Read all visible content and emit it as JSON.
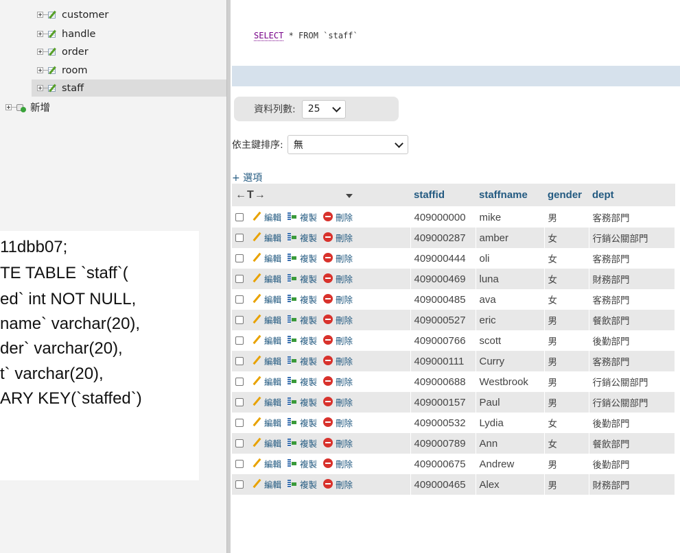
{
  "navigation": {
    "tables": [
      {
        "label": "customer"
      },
      {
        "label": "handle"
      },
      {
        "label": "order"
      },
      {
        "label": "room"
      },
      {
        "label": "staff",
        "selected": true
      }
    ],
    "new_label": "新增"
  },
  "code_snippet": {
    "lines": [
      "11dbb07;",
      "TE TABLE `staff`(",
      "ed` int NOT NULL,",
      "name` varchar(20),",
      "der` varchar(20),",
      "t` varchar(20),",
      "ARY KEY(`staffed`)"
    ]
  },
  "sql": {
    "keyword": "SELECT",
    "rest": " * FROM `staff`"
  },
  "controls": {
    "rows_label": "資料列數:",
    "rows_value": "25",
    "sort_label": "依主鍵排序:",
    "sort_value": "無",
    "options_label": "+ 選項"
  },
  "table": {
    "arrows": "←T→",
    "columns": [
      "staffid",
      "staffname",
      "gender",
      "dept"
    ],
    "actions": {
      "edit": "編輯",
      "copy": "複製",
      "delete": "刪除"
    },
    "rows": [
      {
        "staffid": "409000000",
        "staffname": "mike",
        "gender": "男",
        "dept": "客務部門"
      },
      {
        "staffid": "409000287",
        "staffname": "amber",
        "gender": "女",
        "dept": "行銷公關部門"
      },
      {
        "staffid": "409000444",
        "staffname": "oli",
        "gender": "女",
        "dept": "客務部門"
      },
      {
        "staffid": "409000469",
        "staffname": "luna",
        "gender": "女",
        "dept": "財務部門"
      },
      {
        "staffid": "409000485",
        "staffname": "ava",
        "gender": "女",
        "dept": "客務部門"
      },
      {
        "staffid": "409000527",
        "staffname": "eric",
        "gender": "男",
        "dept": "餐飲部門"
      },
      {
        "staffid": "409000766",
        "staffname": "scott",
        "gender": "男",
        "dept": "後勤部門"
      },
      {
        "staffid": "409000111",
        "staffname": "Curry",
        "gender": "男",
        "dept": "客務部門"
      },
      {
        "staffid": "409000688",
        "staffname": "Westbrook",
        "gender": "男",
        "dept": "行銷公關部門"
      },
      {
        "staffid": "409000157",
        "staffname": "Paul",
        "gender": "男",
        "dept": "行銷公關部門"
      },
      {
        "staffid": "409000532",
        "staffname": "Lydia",
        "gender": "女",
        "dept": "後勤部門"
      },
      {
        "staffid": "409000789",
        "staffname": "Ann",
        "gender": "女",
        "dept": "餐飲部門"
      },
      {
        "staffid": "409000675",
        "staffname": "Andrew",
        "gender": "男",
        "dept": "後勤部門"
      },
      {
        "staffid": "409000465",
        "staffname": "Alex",
        "gender": "男",
        "dept": "財務部門"
      }
    ]
  }
}
